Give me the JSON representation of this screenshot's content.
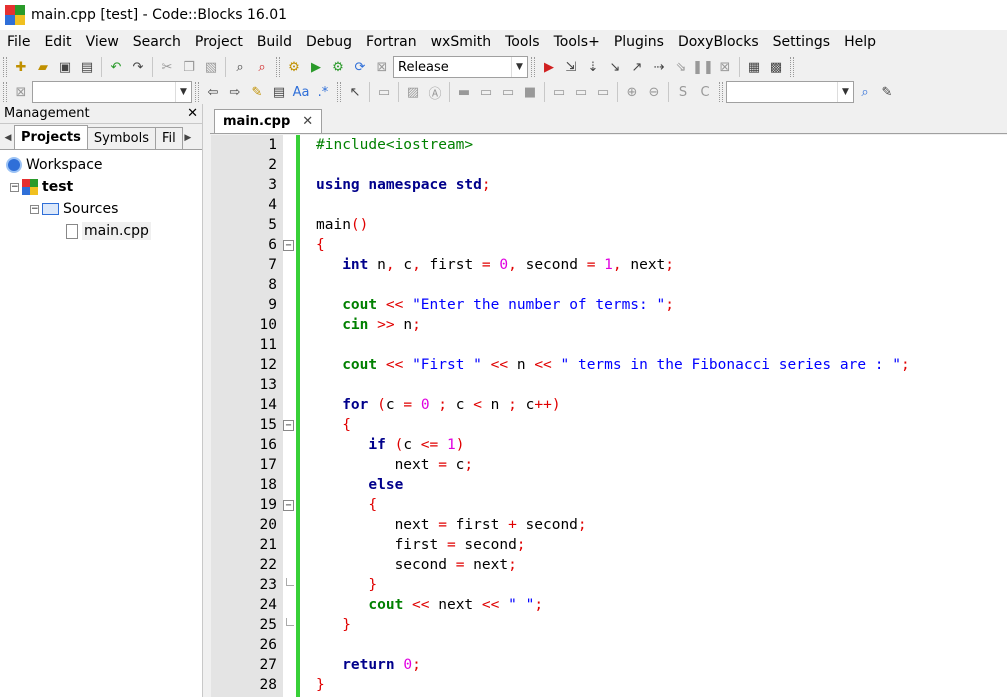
{
  "window": {
    "title": "main.cpp [test] - Code::Blocks 16.01"
  },
  "menu": [
    "File",
    "Edit",
    "View",
    "Search",
    "Project",
    "Build",
    "Debug",
    "Fortran",
    "wxSmith",
    "Tools",
    "Tools+",
    "Plugins",
    "DoxyBlocks",
    "Settings",
    "Help"
  ],
  "toolbar": {
    "build_target": "Release",
    "scope_value": "",
    "search_value": ""
  },
  "management": {
    "title": "Management",
    "close": "✕",
    "tabs": [
      "Projects",
      "Symbols",
      "Fil"
    ],
    "tree": {
      "workspace": "Workspace",
      "project": "test",
      "folder": "Sources",
      "file": "main.cpp"
    }
  },
  "editor": {
    "tab_label": "main.cpp",
    "tab_close": "✕",
    "lines": [
      [
        [
          "pp",
          "#include<iostream>"
        ]
      ],
      [],
      [
        [
          "kw",
          "using"
        ],
        [
          "t",
          " "
        ],
        [
          "kw",
          "namespace"
        ],
        [
          "t",
          " "
        ],
        [
          "kw",
          "std"
        ],
        [
          "op",
          ";"
        ]
      ],
      [],
      [
        [
          "t",
          "main"
        ],
        [
          "op",
          "()"
        ]
      ],
      [
        [
          "op",
          "{"
        ]
      ],
      [
        [
          "t",
          "   "
        ],
        [
          "kw",
          "int"
        ],
        [
          "t",
          " n"
        ],
        [
          "op",
          ","
        ],
        [
          "t",
          " c"
        ],
        [
          "op",
          ","
        ],
        [
          "t",
          " first "
        ],
        [
          "op",
          "="
        ],
        [
          "t",
          " "
        ],
        [
          "num",
          "0"
        ],
        [
          "op",
          ","
        ],
        [
          "t",
          " second "
        ],
        [
          "op",
          "="
        ],
        [
          "t",
          " "
        ],
        [
          "num",
          "1"
        ],
        [
          "op",
          ","
        ],
        [
          "t",
          " next"
        ],
        [
          "op",
          ";"
        ]
      ],
      [],
      [
        [
          "t",
          "   "
        ],
        [
          "kw2",
          "cout"
        ],
        [
          "t",
          " "
        ],
        [
          "op",
          "<<"
        ],
        [
          "t",
          " "
        ],
        [
          "str",
          "\"Enter the number of terms: \""
        ],
        [
          "op",
          ";"
        ]
      ],
      [
        [
          "t",
          "   "
        ],
        [
          "kw2",
          "cin"
        ],
        [
          "t",
          " "
        ],
        [
          "op",
          ">>"
        ],
        [
          "t",
          " n"
        ],
        [
          "op",
          ";"
        ]
      ],
      [],
      [
        [
          "t",
          "   "
        ],
        [
          "kw2",
          "cout"
        ],
        [
          "t",
          " "
        ],
        [
          "op",
          "<<"
        ],
        [
          "t",
          " "
        ],
        [
          "str",
          "\"First \""
        ],
        [
          "t",
          " "
        ],
        [
          "op",
          "<<"
        ],
        [
          "t",
          " n "
        ],
        [
          "op",
          "<<"
        ],
        [
          "t",
          " "
        ],
        [
          "str",
          "\" terms in the Fibonacci series are : \""
        ],
        [
          "op",
          ";"
        ]
      ],
      [],
      [
        [
          "t",
          "   "
        ],
        [
          "kw",
          "for"
        ],
        [
          "t",
          " "
        ],
        [
          "op",
          "("
        ],
        [
          "t",
          "c "
        ],
        [
          "op",
          "="
        ],
        [
          "t",
          " "
        ],
        [
          "num",
          "0"
        ],
        [
          "t",
          " "
        ],
        [
          "op",
          ";"
        ],
        [
          "t",
          " c "
        ],
        [
          "op",
          "<"
        ],
        [
          "t",
          " n "
        ],
        [
          "op",
          ";"
        ],
        [
          "t",
          " c"
        ],
        [
          "op",
          "++)"
        ]
      ],
      [
        [
          "t",
          "   "
        ],
        [
          "op",
          "{"
        ]
      ],
      [
        [
          "t",
          "      "
        ],
        [
          "kw",
          "if"
        ],
        [
          "t",
          " "
        ],
        [
          "op",
          "("
        ],
        [
          "t",
          "c "
        ],
        [
          "op",
          "<="
        ],
        [
          "t",
          " "
        ],
        [
          "num",
          "1"
        ],
        [
          "op",
          ")"
        ]
      ],
      [
        [
          "t",
          "         next "
        ],
        [
          "op",
          "="
        ],
        [
          "t",
          " c"
        ],
        [
          "op",
          ";"
        ]
      ],
      [
        [
          "t",
          "      "
        ],
        [
          "kw",
          "else"
        ]
      ],
      [
        [
          "t",
          "      "
        ],
        [
          "op",
          "{"
        ]
      ],
      [
        [
          "t",
          "         next "
        ],
        [
          "op",
          "="
        ],
        [
          "t",
          " first "
        ],
        [
          "op",
          "+"
        ],
        [
          "t",
          " second"
        ],
        [
          "op",
          ";"
        ]
      ],
      [
        [
          "t",
          "         first "
        ],
        [
          "op",
          "="
        ],
        [
          "t",
          " second"
        ],
        [
          "op",
          ";"
        ]
      ],
      [
        [
          "t",
          "         second "
        ],
        [
          "op",
          "="
        ],
        [
          "t",
          " next"
        ],
        [
          "op",
          ";"
        ]
      ],
      [
        [
          "t",
          "      "
        ],
        [
          "op",
          "}"
        ]
      ],
      [
        [
          "t",
          "      "
        ],
        [
          "kw2",
          "cout"
        ],
        [
          "t",
          " "
        ],
        [
          "op",
          "<<"
        ],
        [
          "t",
          " next "
        ],
        [
          "op",
          "<<"
        ],
        [
          "t",
          " "
        ],
        [
          "str",
          "\" \""
        ],
        [
          "op",
          ";"
        ]
      ],
      [
        [
          "t",
          "   "
        ],
        [
          "op",
          "}"
        ]
      ],
      [],
      [
        [
          "t",
          "   "
        ],
        [
          "kw",
          "return"
        ],
        [
          "t",
          " "
        ],
        [
          "num",
          "0"
        ],
        [
          "op",
          ";"
        ]
      ],
      [
        [
          "op",
          "}"
        ]
      ]
    ],
    "fold_open_lines": [
      6,
      15,
      19
    ],
    "fold_end_lines": [
      23,
      25
    ]
  }
}
